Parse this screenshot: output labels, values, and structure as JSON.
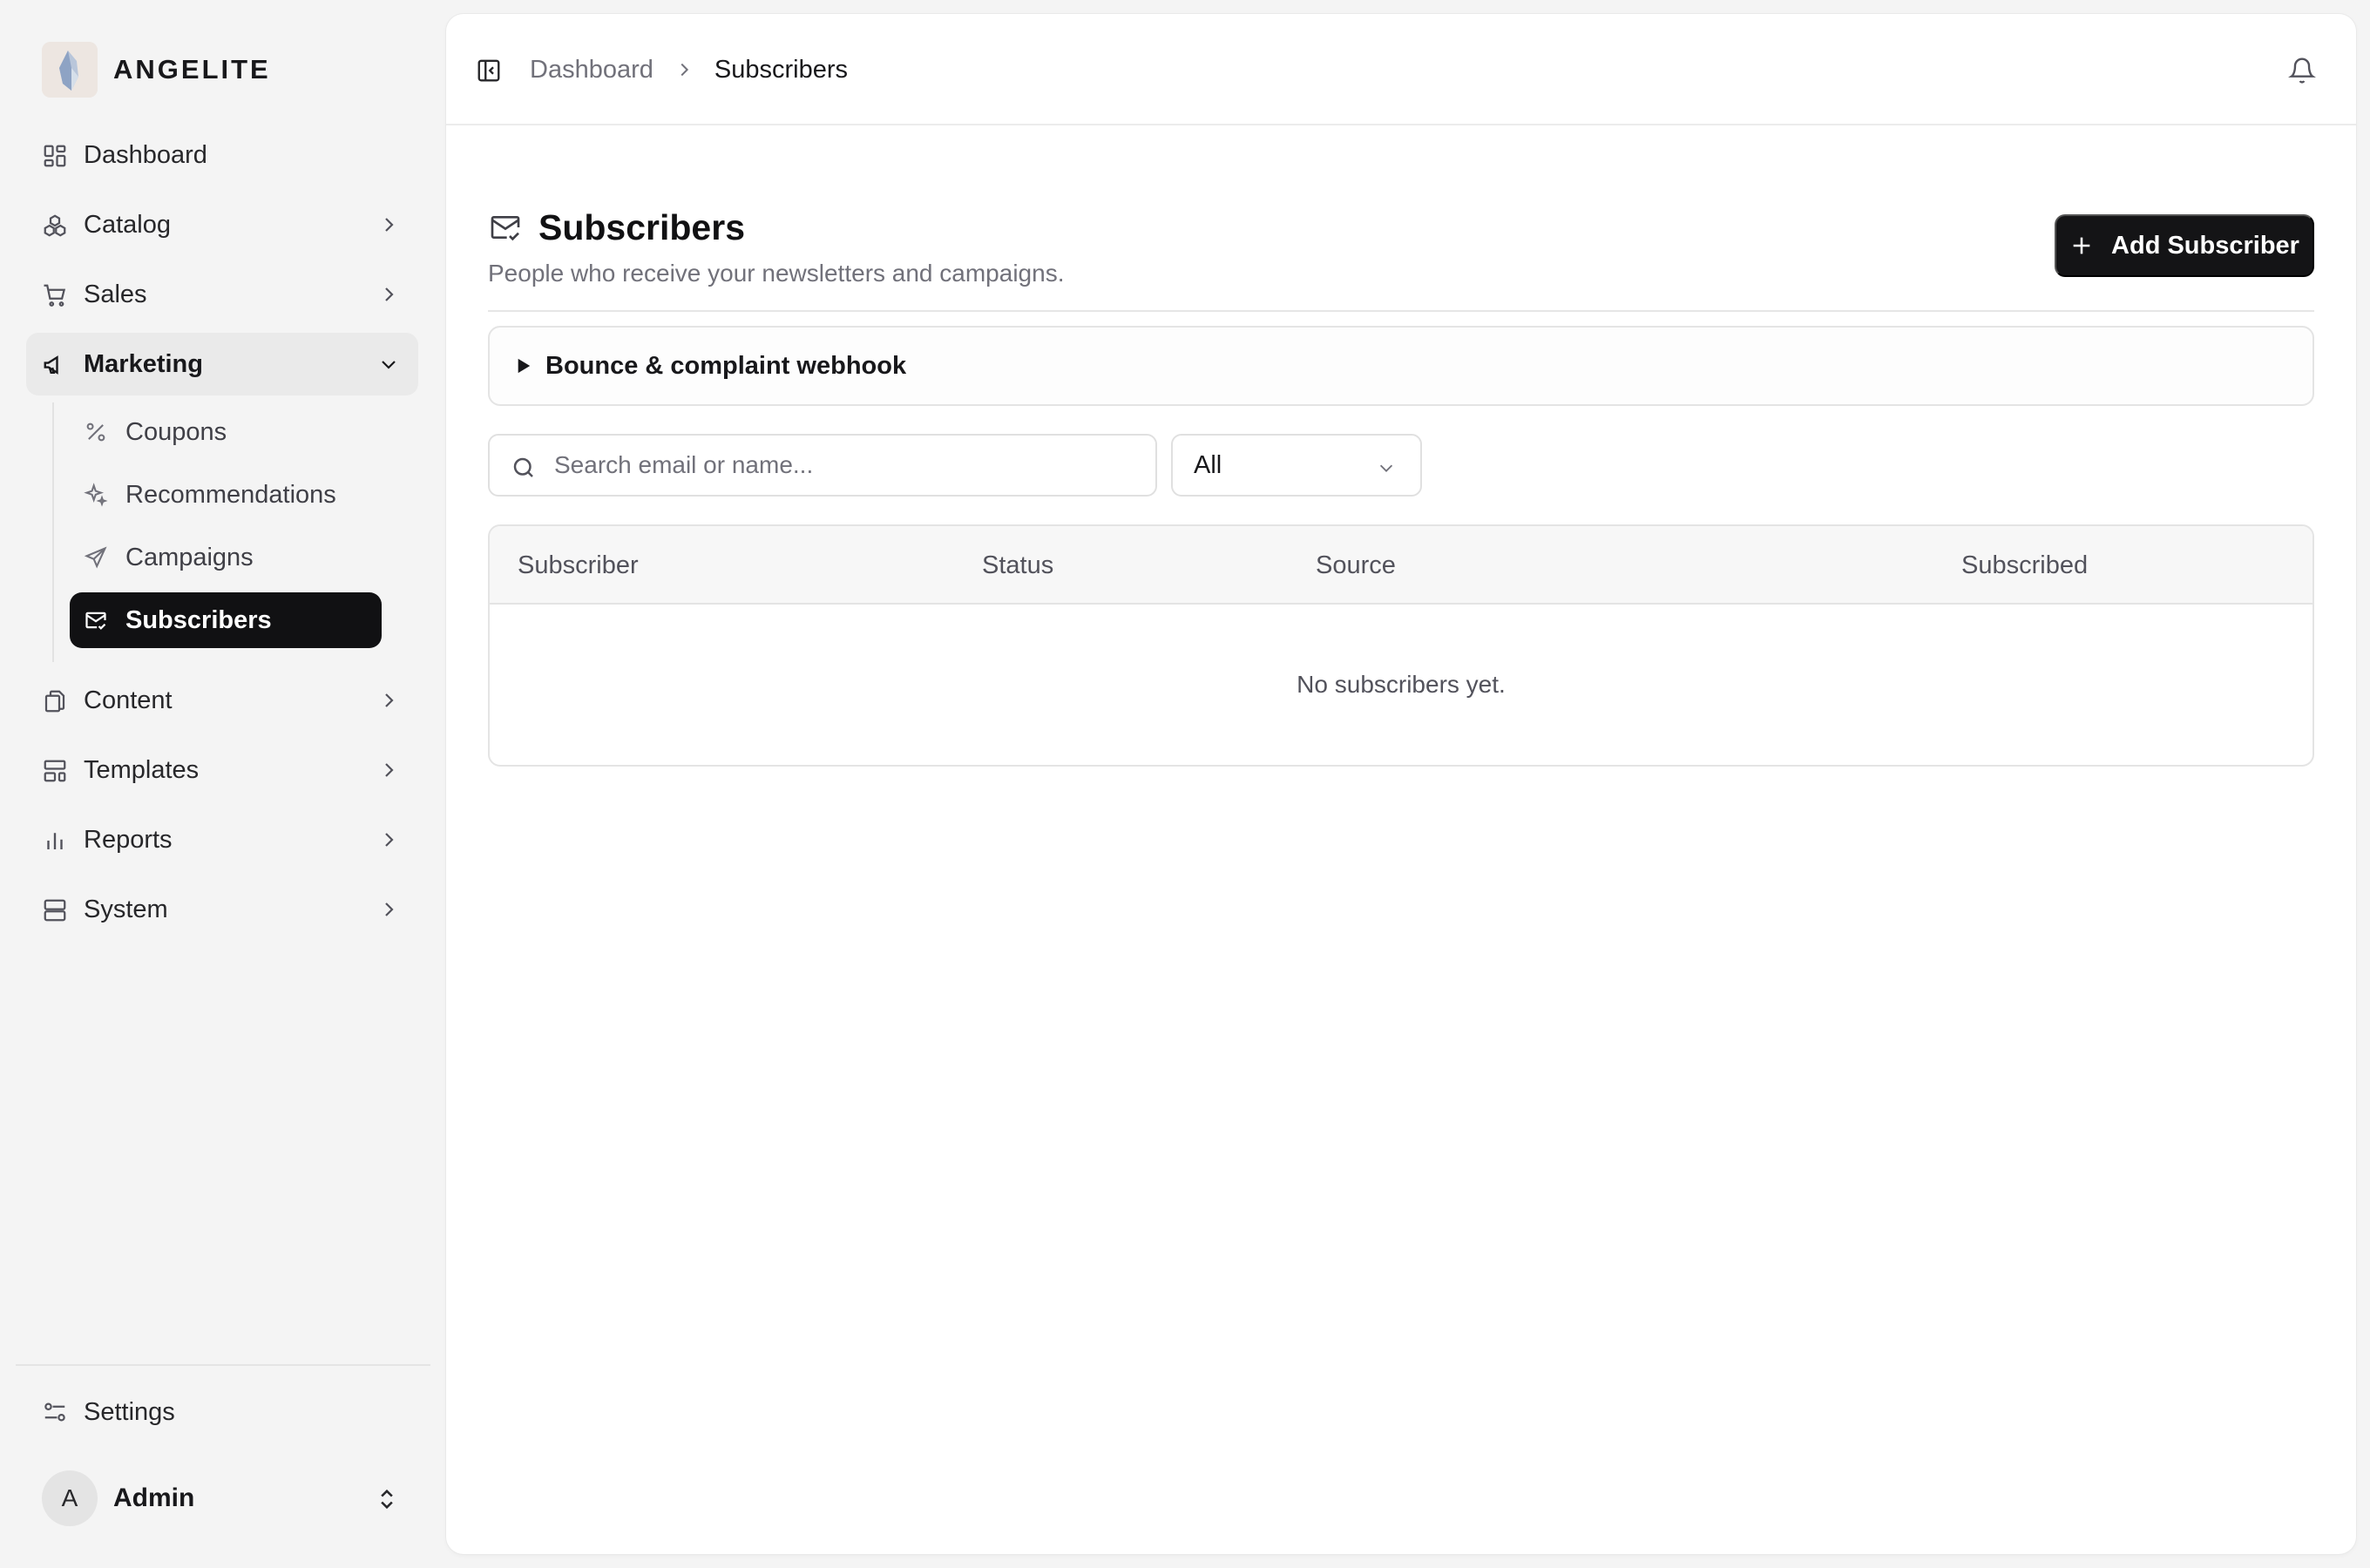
{
  "brand": {
    "name": "ANGELITE"
  },
  "sidebar": {
    "items": [
      {
        "label": "Dashboard"
      },
      {
        "label": "Catalog"
      },
      {
        "label": "Sales"
      },
      {
        "label": "Marketing"
      },
      {
        "label": "Content"
      },
      {
        "label": "Templates"
      },
      {
        "label": "Reports"
      },
      {
        "label": "System"
      }
    ],
    "marketing_sub": [
      {
        "label": "Coupons"
      },
      {
        "label": "Recommendations"
      },
      {
        "label": "Campaigns"
      },
      {
        "label": "Subscribers"
      }
    ],
    "settings_label": "Settings",
    "user": {
      "initial": "A",
      "name": "Admin"
    }
  },
  "breadcrumb": {
    "parent": "Dashboard",
    "current": "Subscribers"
  },
  "page": {
    "title": "Subscribers",
    "subtitle": "People who receive your newsletters and campaigns.",
    "add_button": "Add Subscriber"
  },
  "webhook": {
    "label": "Bounce & complaint webhook"
  },
  "filters": {
    "search_placeholder": "Search email or name...",
    "status_value": "All"
  },
  "table": {
    "columns": [
      "Subscriber",
      "Status",
      "Source",
      "Subscribed"
    ],
    "empty_message": "No subscribers yet."
  },
  "colors": {
    "active_bg": "#111113",
    "primary_button": "#141416",
    "accent_text": "#71717a"
  }
}
